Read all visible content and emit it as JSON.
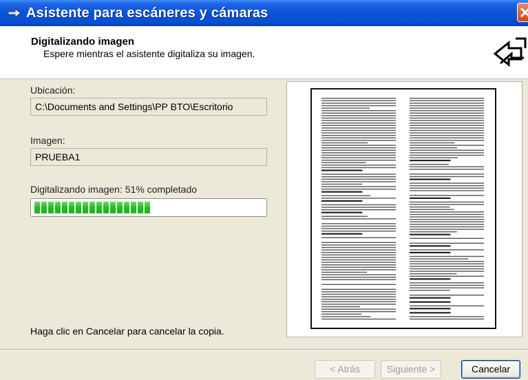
{
  "window": {
    "title": "Asistente para escáneres y cámaras"
  },
  "header": {
    "title": "Digitalizando imagen",
    "subtitle": "Espere mientras el asistente digitaliza su imagen."
  },
  "location": {
    "label": "Ubicación:",
    "value": "C:\\Documents and Settings\\PP BTO\\Escritorio"
  },
  "image": {
    "label": "Imagen:",
    "value": "PRUEBA1"
  },
  "progress": {
    "label": "Digitalizando imagen: 51% completado",
    "percent": 51
  },
  "footer": {
    "hint": "Haga clic en Cancelar para cancelar la copia."
  },
  "buttons": {
    "back": "< Atrás",
    "next": "Siguiente >",
    "cancel": "Cancelar"
  },
  "icons": {
    "title": "scanner-arrow-icon",
    "header": "scanner-wizard-icon",
    "close": "close-icon"
  },
  "colors": {
    "titlebar": "#0a53d8",
    "progress": "#1ec21e",
    "close": "#d5431d"
  }
}
